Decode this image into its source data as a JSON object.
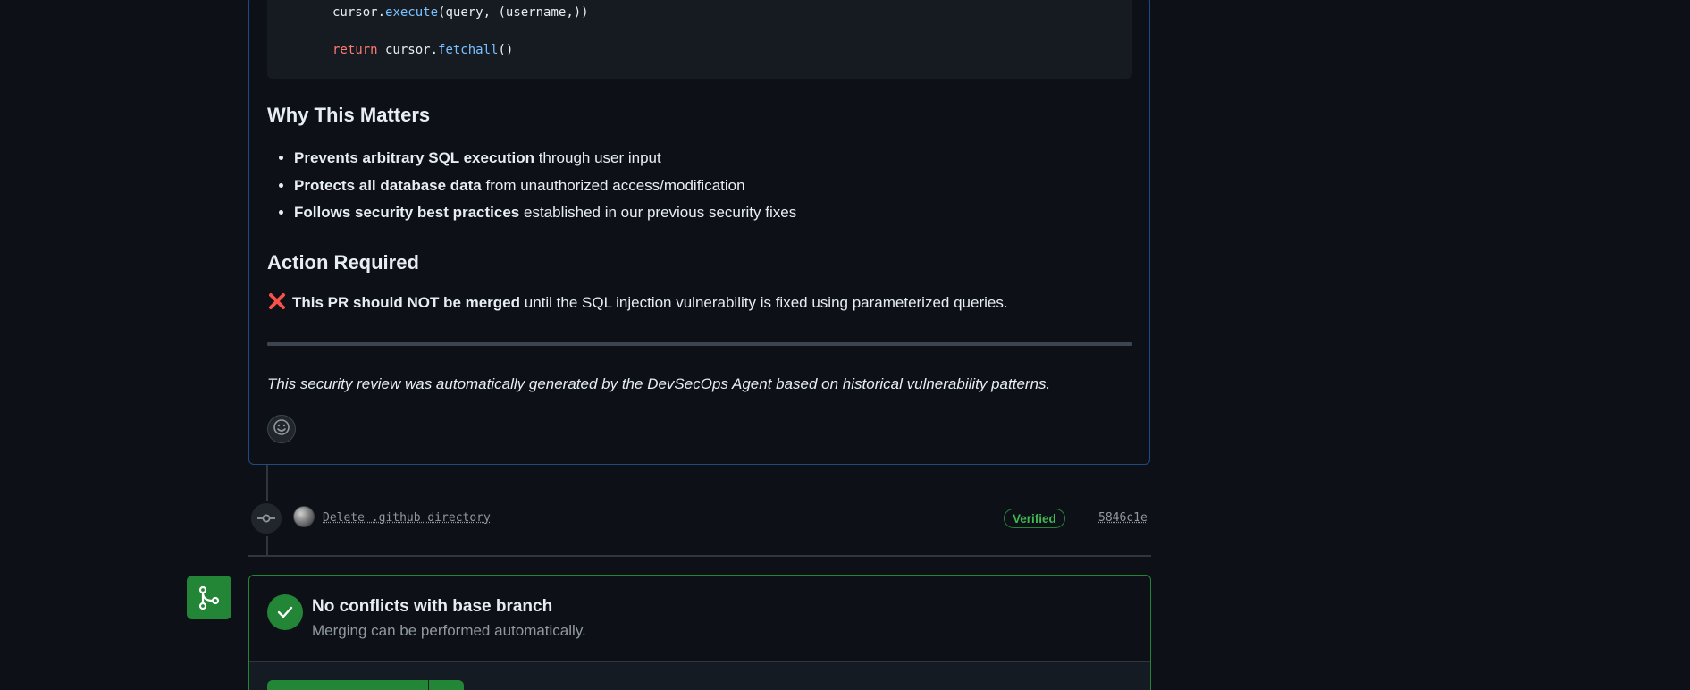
{
  "code": {
    "line1_obj": "cursor.",
    "line1_fn": "execute",
    "line1_args": "(query, (username,))",
    "line2_kw": "return",
    "line2_obj": " cursor.",
    "line2_fn": "fetchall",
    "line2_args": "()"
  },
  "why": {
    "heading": "Why This Matters",
    "items": [
      {
        "bold": "Prevents arbitrary SQL execution",
        "rest": " through user input"
      },
      {
        "bold": "Protects all database data",
        "rest": " from unauthorized access/modification"
      },
      {
        "bold": "Follows security best practices",
        "rest": " established in our previous security fixes"
      }
    ]
  },
  "action": {
    "heading": "Action Required",
    "bold": "This PR should NOT be merged",
    "rest": " until the SQL injection vulnerability is fixed using parameterized queries."
  },
  "note": "This security review was automatically generated by the DevSecOps Agent based on historical vulnerability patterns.",
  "commit": {
    "message": "Delete .github directory",
    "badge": "Verified",
    "sha": "5846c1e"
  },
  "merge": {
    "title": "No conflicts with base branch",
    "subtitle": "Merging can be performed automatically."
  },
  "colors": {
    "accent_green": "#238636",
    "verified_text": "#3fb950",
    "danger": "#f85149",
    "border_blue": "#1f4b85"
  },
  "icons": [
    "x-mark-icon",
    "smiley-icon",
    "git-commit-icon",
    "git-merge-icon",
    "check-icon"
  ]
}
